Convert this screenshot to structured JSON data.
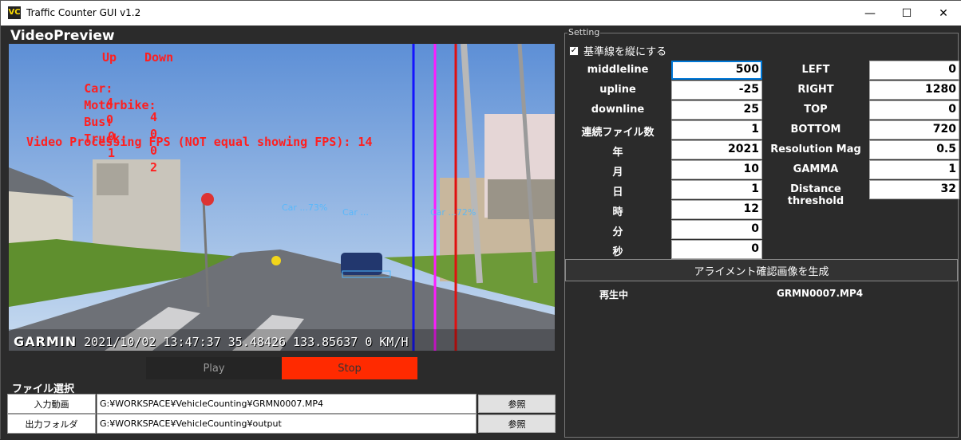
{
  "window": {
    "title": "Traffic Counter GUI v1.2",
    "minimize_glyph": "—",
    "maximize_glyph": "☐",
    "close_glyph": "✕"
  },
  "video_preview": {
    "heading": "VideoPreview",
    "overlay": {
      "header_up": "Up",
      "header_down": "Down",
      "rows": [
        {
          "label": "Car:",
          "up": "4",
          "down": "4"
        },
        {
          "label": "Motorbike:",
          "up": "0",
          "down": "0"
        },
        {
          "label": "Bus:",
          "up": "0",
          "down": "0"
        },
        {
          "label": "Truck:",
          "up": "1",
          "down": "2"
        }
      ],
      "fps_text": "Video Processing FPS (NOT equal showing FPS): 14"
    },
    "garmin_brand": "GARMIN",
    "garmin_info": "2021/10/02 13:47:37 35.48426 133.85637 0 KM/H",
    "detections": [
      "Car ...73%",
      "Car ...",
      "Car ...72%"
    ],
    "line_colors": {
      "blue": "#1414ff",
      "magenta": "#ff1aff",
      "red": "#e01010"
    }
  },
  "controls": {
    "play_label": "Play",
    "stop_label": "Stop",
    "stop_color": "#ff2a00"
  },
  "file_select": {
    "heading": "ファイル選択",
    "input_label": "入力動画",
    "input_path": "G:¥WORKSPACE¥VehicleCounting¥GRMN0007.MP4",
    "input_browse": "参照",
    "output_label": "出力フォルダ",
    "output_path": "G:¥WORKSPACE¥VehicleCounting¥output",
    "output_browse": "参照"
  },
  "setting": {
    "group_label": "Setting",
    "vertical_checkbox_label": "基準線を縦にする",
    "vertical_checked": true,
    "left_fields": [
      {
        "label": "middleline",
        "value": "500"
      },
      {
        "label": "upline",
        "value": "-25"
      },
      {
        "label": "downline",
        "value": "25"
      },
      {
        "label": "連続ファイル数",
        "value": "1"
      },
      {
        "label": "年",
        "value": "2021"
      },
      {
        "label": "月",
        "value": "10"
      },
      {
        "label": "日",
        "value": "1"
      },
      {
        "label": "時",
        "value": "12"
      },
      {
        "label": "分",
        "value": "0"
      },
      {
        "label": "秒",
        "value": "0"
      }
    ],
    "right_fields": [
      {
        "label": "LEFT",
        "value": "0"
      },
      {
        "label": "RIGHT",
        "value": "1280"
      },
      {
        "label": "TOP",
        "value": "0"
      },
      {
        "label": "BOTTOM",
        "value": "720"
      },
      {
        "label": "Resolution Mag",
        "value": "0.5"
      },
      {
        "label": "GAMMA",
        "value": "1"
      },
      {
        "label": "Distance threshold",
        "value": "32"
      }
    ],
    "alignment_button": "アライメント確認画像を生成",
    "status_label": "再生中",
    "status_file": "GRMN0007.MP4"
  }
}
